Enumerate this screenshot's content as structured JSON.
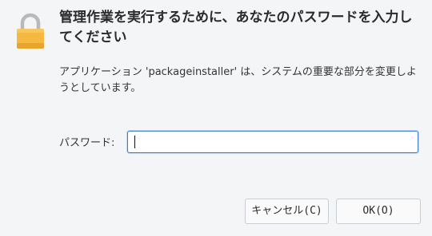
{
  "dialog": {
    "icon": "lock-icon",
    "title": "管理作業を実行するために、あなたのパスワードを入力してください",
    "message": "アプリケーション 'packageinstaller' は、システムの重要な部分を変更しようとしています。",
    "password": {
      "label": "パスワード:",
      "value": "",
      "placeholder": ""
    },
    "buttons": {
      "cancel_label": "キャンセル(C)",
      "ok_label": "OK(O)"
    }
  },
  "colors": {
    "background": "#f4f5f7",
    "lock_body": "#f5b940",
    "lock_shackle": "#b8b8b8",
    "focus_border": "#3b7fd1"
  }
}
